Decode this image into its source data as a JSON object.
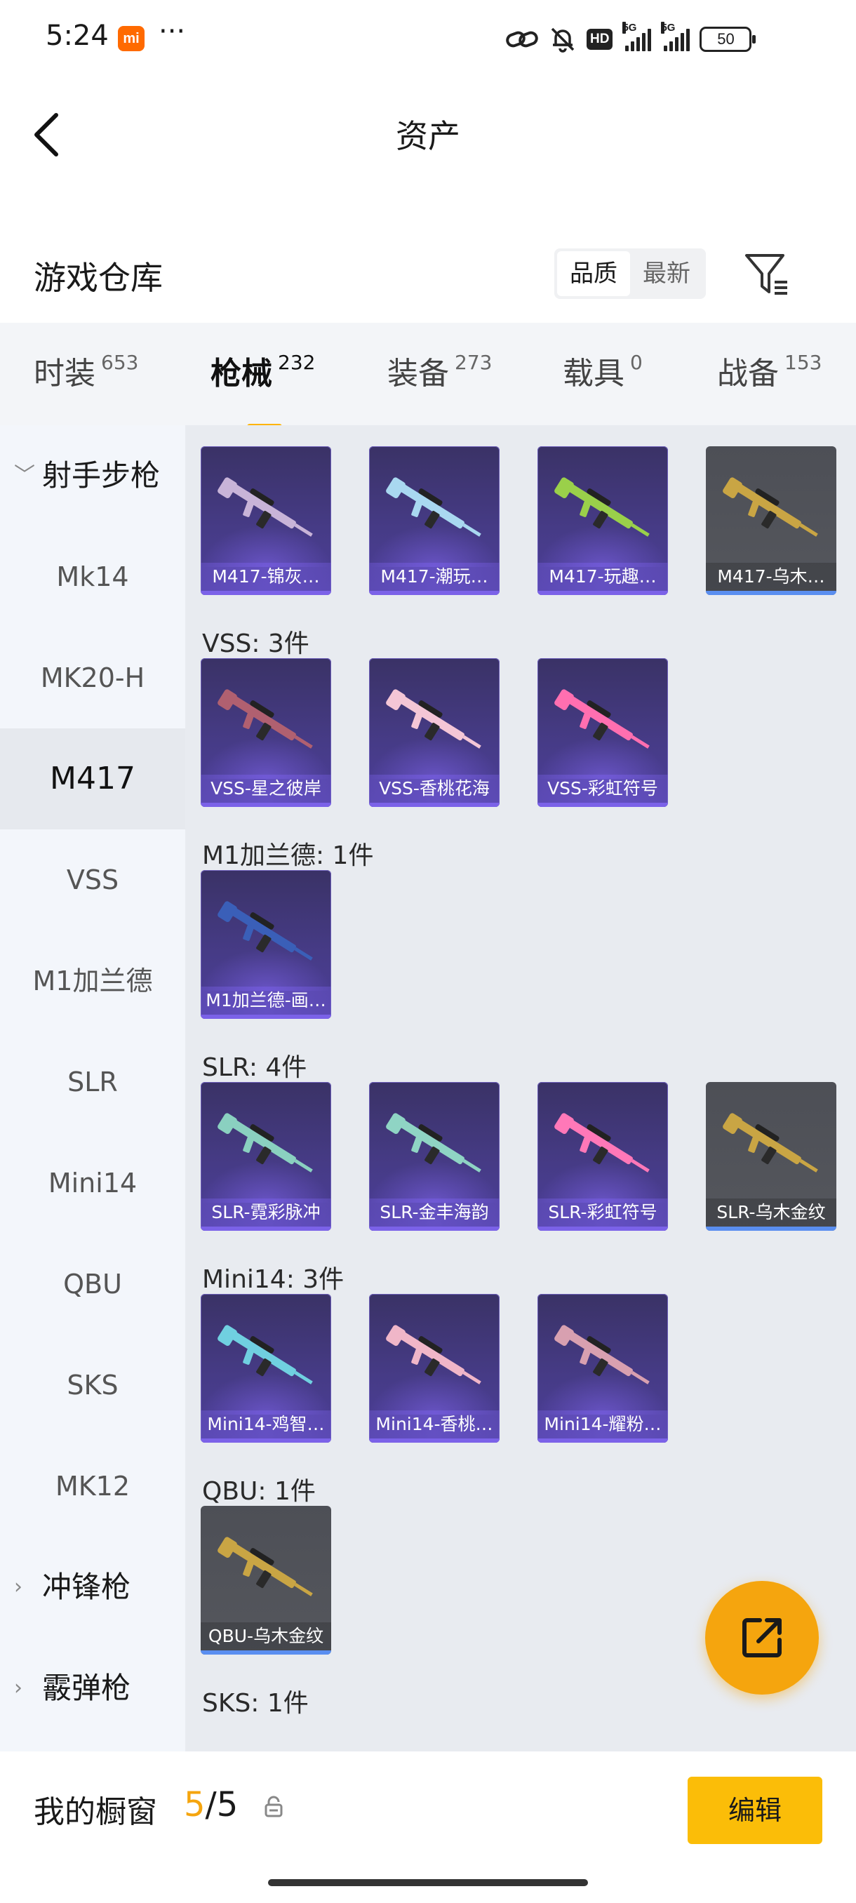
{
  "status_bar": {
    "time": "5:24",
    "mi_badge": "mi",
    "dots": "···",
    "hd": "HD",
    "sig1": "5G",
    "sig2": "5G",
    "battery": "50"
  },
  "nav": {
    "title": "资产",
    "back_icon": "back-chevron-icon"
  },
  "header": {
    "title": "游戏仓库",
    "sort_options": [
      "品质",
      "最新"
    ],
    "sort_selected": "品质",
    "filter_icon": "filter-icon"
  },
  "categories": [
    {
      "label": "时装",
      "count": "653"
    },
    {
      "label": "枪械",
      "count": "232",
      "selected": true
    },
    {
      "label": "装备",
      "count": "273"
    },
    {
      "label": "载具",
      "count": "0"
    },
    {
      "label": "战备",
      "count": "153"
    }
  ],
  "sidebar": {
    "items": [
      {
        "label": "射手步枪",
        "group": true,
        "expanded": true
      },
      {
        "label": "Mk14"
      },
      {
        "label": "MK20-H"
      },
      {
        "label": "M417",
        "selected": true
      },
      {
        "label": "VSS"
      },
      {
        "label": "M1加兰德"
      },
      {
        "label": "SLR"
      },
      {
        "label": "Mini14"
      },
      {
        "label": "QBU"
      },
      {
        "label": "SKS"
      },
      {
        "label": "MK12"
      },
      {
        "label": "冲锋枪",
        "group": true
      },
      {
        "label": "霰弹枪",
        "group": true
      }
    ]
  },
  "sections": [
    {
      "label": "",
      "items": [
        {
          "name": "M417-锦灰…",
          "rarity": "purple",
          "color": "#c8b4d8"
        },
        {
          "name": "M417-潮玩…",
          "rarity": "purple",
          "color": "#a9d8f0"
        },
        {
          "name": "M417-玩趣…",
          "rarity": "purple",
          "color": "#9ad04a"
        },
        {
          "name": "M417-乌木…",
          "rarity": "gold",
          "color": "#c9a544"
        }
      ]
    },
    {
      "label": "VSS: 3件",
      "items": [
        {
          "name": "VSS-星之彼岸",
          "rarity": "purple",
          "color": "#b06070"
        },
        {
          "name": "VSS-香桃花海",
          "rarity": "purple",
          "color": "#f4c6d6"
        },
        {
          "name": "VSS-彩虹符号",
          "rarity": "purple",
          "color": "#ff6fb0"
        }
      ]
    },
    {
      "label": "M1加兰德: 1件",
      "items": [
        {
          "name": "M1加兰德-画…",
          "rarity": "purple",
          "color": "#3a5fb8"
        }
      ]
    },
    {
      "label": "SLR: 4件",
      "items": [
        {
          "name": "SLR-霓彩脉冲",
          "rarity": "purple",
          "color": "#8ad0c0"
        },
        {
          "name": "SLR-金丰海韵",
          "rarity": "purple",
          "color": "#8fd4c4"
        },
        {
          "name": "SLR-彩虹符号",
          "rarity": "purple",
          "color": "#ff78b8"
        },
        {
          "name": "SLR-乌木金纹",
          "rarity": "gold",
          "color": "#c9a544"
        }
      ]
    },
    {
      "label": "Mini14: 3件",
      "items": [
        {
          "name": "Mini14-鸡智…",
          "rarity": "purple",
          "color": "#70d0e0"
        },
        {
          "name": "Mini14-香桃…",
          "rarity": "purple",
          "color": "#f0b6c8"
        },
        {
          "name": "Mini14-耀粉…",
          "rarity": "purple",
          "color": "#d8a0b0"
        }
      ]
    },
    {
      "label": "QBU: 1件",
      "items": [
        {
          "name": "QBU-乌木金纹",
          "rarity": "gold",
          "color": "#c9a544"
        }
      ]
    },
    {
      "label": "SKS: 1件",
      "items": []
    }
  ],
  "share_button": {
    "icon": "share-export-icon"
  },
  "bottom_bar": {
    "label": "我的橱窗",
    "count_current": "5",
    "count_sep": "/",
    "count_total": "5",
    "edit_label": "编辑"
  }
}
